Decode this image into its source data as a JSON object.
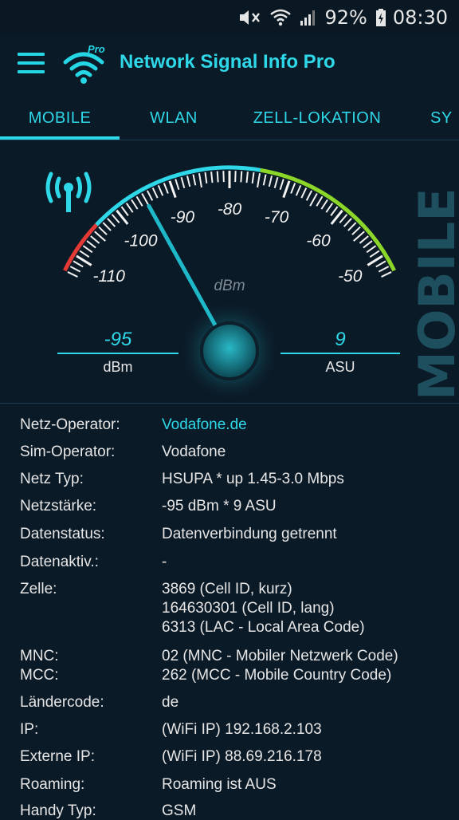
{
  "status_bar": {
    "battery_percent": "92%",
    "time": "08:30",
    "icons": [
      "mute-icon",
      "wifi-icon",
      "cell-signal-icon",
      "battery-charging-icon"
    ]
  },
  "app": {
    "title": "Network Signal Info Pro",
    "logo_badge": "Pro"
  },
  "tabs": [
    {
      "label": "MOBILE",
      "active": true
    },
    {
      "label": "WLAN",
      "active": false
    },
    {
      "label": "ZELL-LOKATION",
      "active": false
    },
    {
      "label": "SY",
      "active": false
    }
  ],
  "gauge": {
    "scale_labels": [
      "-110",
      "-100",
      "-90",
      "-80",
      "-70",
      "-60",
      "-50"
    ],
    "unit_center": "dBm",
    "value_dbm": -95,
    "side_label": "MOBILE",
    "left_readout": {
      "value": "-95",
      "unit": "dBm"
    },
    "right_readout": {
      "value": "9",
      "unit": "ASU"
    },
    "colors": {
      "low": "#e53935",
      "mid": "#2fd8e8",
      "high": "#8bd629",
      "needle": "#1fb8c9"
    }
  },
  "info": {
    "operator": {
      "label": "Netz-Operator:",
      "value": "Vodafone.de"
    },
    "sim_operator": {
      "label": "Sim-Operator:",
      "value": "Vodafone"
    },
    "network_type": {
      "label": "Netz Typ:",
      "value": "HSUPA * up 1.45-3.0 Mbps"
    },
    "strength": {
      "label": "Netzstärke:",
      "value": "-95 dBm * 9 ASU"
    },
    "data_status": {
      "label": "Datenstatus:",
      "value": "Datenverbindung getrennt"
    },
    "data_activity": {
      "label": "Datenaktiv.:",
      "value": "-"
    },
    "cell": {
      "label": "Zelle:",
      "lines": [
        "3869 (Cell ID, kurz)",
        "164630301 (Cell ID, lang)",
        "6313 (LAC - Local Area Code)"
      ]
    },
    "mnc": {
      "label": "MNC:",
      "value": "02 (MNC - Mobiler Netzwerk Code)"
    },
    "mcc": {
      "label": "MCC:",
      "value": "262 (MCC - Mobile Country Code)"
    },
    "country_code": {
      "label": "Ländercode:",
      "value": "de"
    },
    "ip": {
      "label": "IP:",
      "value": "(WiFi IP) 192.168.2.103"
    },
    "external_ip": {
      "label": "Externe IP:",
      "value": "(WiFi IP) 88.69.216.178"
    },
    "roaming": {
      "label": "Roaming:",
      "value": "Roaming ist AUS"
    },
    "phone_type": {
      "label": "Handy Typ:",
      "value": "GSM"
    }
  }
}
